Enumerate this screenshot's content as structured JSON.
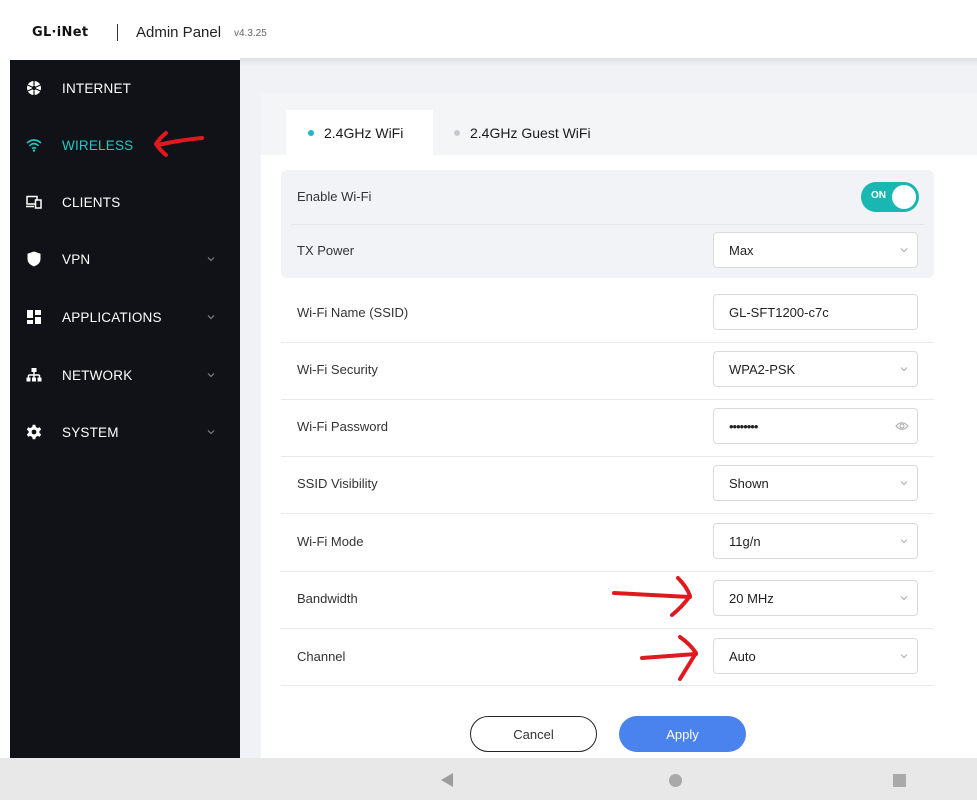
{
  "header": {
    "logo": "GL·iNet",
    "title": "Admin Panel",
    "version": "v4.3.25"
  },
  "sidebar": {
    "items": [
      {
        "label": "INTERNET",
        "icon": "internet-icon"
      },
      {
        "label": "WIRELESS",
        "icon": "wifi-icon",
        "active": true
      },
      {
        "label": "CLIENTS",
        "icon": "clients-icon"
      },
      {
        "label": "VPN",
        "icon": "shield-icon",
        "has_submenu": true
      },
      {
        "label": "APPLICATIONS",
        "icon": "applications-icon",
        "has_submenu": true
      },
      {
        "label": "NETWORK",
        "icon": "network-icon",
        "has_submenu": true
      },
      {
        "label": "SYSTEM",
        "icon": "gear-icon",
        "has_submenu": true
      }
    ]
  },
  "tabs": [
    {
      "label": "2.4GHz WiFi",
      "active": true
    },
    {
      "label": "2.4GHz Guest WiFi",
      "active": false
    }
  ],
  "settings": {
    "enable_wifi": {
      "label": "Enable Wi-Fi",
      "toggle": "ON"
    },
    "tx_power": {
      "label": "TX Power",
      "value": "Max"
    },
    "ssid": {
      "label": "Wi-Fi Name (SSID)",
      "value": "GL-SFT1200-c7c"
    },
    "security": {
      "label": "Wi-Fi Security",
      "value": "WPA2-PSK"
    },
    "password": {
      "label": "Wi-Fi Password",
      "value": "••••••••"
    },
    "ssid_visibility": {
      "label": "SSID Visibility",
      "value": "Shown"
    },
    "wifi_mode": {
      "label": "Wi-Fi Mode",
      "value": "11g/n"
    },
    "bandwidth": {
      "label": "Bandwidth",
      "value": "20 MHz"
    },
    "channel": {
      "label": "Channel",
      "value": "Auto"
    }
  },
  "actions": {
    "cancel": "Cancel",
    "apply": "Apply"
  },
  "colors": {
    "accent": "#1fc8c2",
    "toggle_on": "#19b7b2",
    "apply_button": "#4a82ee",
    "sidebar_bg": "#111217",
    "annotation_red": "#e0191f"
  }
}
